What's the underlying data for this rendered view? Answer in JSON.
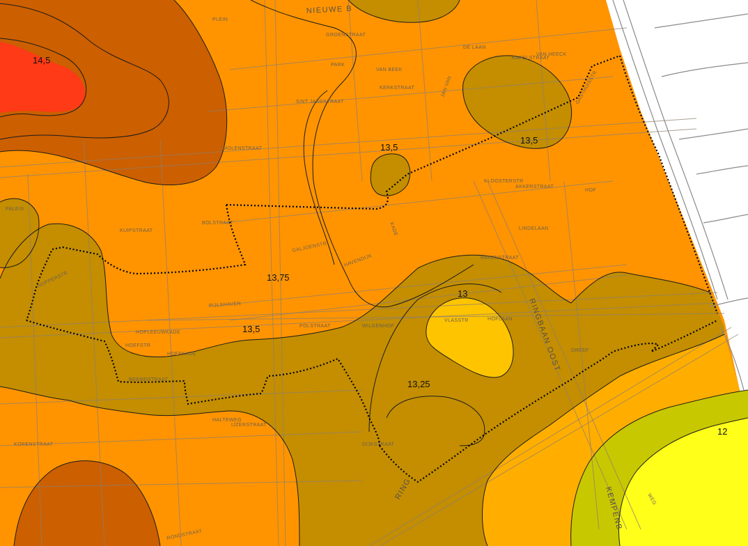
{
  "colors": {
    "zone_red": "#ff3a16",
    "zone_dark_orange": "#cc5f00",
    "zone_orange": "#ff9400",
    "zone_olive": "#c48e00",
    "zone_yellow_orange": "#ffc400",
    "zone_pale_orange": "#ffae00",
    "zone_yellow_green": "#c8c800",
    "zone_yellow": "#ffff1a",
    "outside": "#ffffff"
  },
  "contour_labels": {
    "l145": "14,5",
    "l135_top": "13,5",
    "l135_right": "13,5",
    "l1375": "13,75",
    "l135_mid": "13,5",
    "l13": "13",
    "l1325": "13,25",
    "l12": "12"
  },
  "streets": {
    "nieuwe": "NIEUWE B",
    "ringbaan_oost": "RINGBAAN OOST",
    "ringbaan_bottom": "RING",
    "kempenb": "KEMPENB",
    "pijlshaven": "PIJLSHAVEN",
    "bolstraat": "BOLSTRAAT",
    "kuipstraat": "KUIPSTRAAT",
    "galjoenstr": "GALJOENSTR",
    "havendijk": "HAVENDIJK",
    "hopperstr": "HOPPERSTR",
    "hopleeuwkade": "HOPLEEUWKADE",
    "rondstraat": "RONDSTRAAT",
    "halteweg": "HALTEWEG",
    "wilgenhof": "WILGENHOF",
    "molenstraat": "MOLENSTRAAT",
    "sintjansstraat": "SINT JANSSTRAAT",
    "paleis": "PALEIS",
    "hoflaan": "HOFLAAN",
    "vlasstr": "VLASSTR",
    "hoefstr": "HOEFSTR",
    "polstraat": "POLSTRAAT",
    "kerkstraat": "KERKSTRAAT",
    "akkerstraat": "AKKERSTRAAT",
    "lindelaan": "LINDELAAN",
    "beemdstraat": "BEEMDSTRAAT",
    "korenstraat": "KORENSTRAAT",
    "ijzerstraat": "IJZERSTRAAT",
    "groenstraat": "GROENSTRAAT",
    "havenstraat": "HAVENSTRAAT",
    "hoefkade": "HOEFKADE",
    "dijkstraat": "DIJKSTRAAT",
    "kapelstraat": "KAPELSTRAAT",
    "gasthuisstr": "GASTHUISSTR",
    "kloosterstr": "KLOOSTERSTR",
    "jan_van": "JAN VAN",
    "van_heeck": "VAN HEECK",
    "van_beek": "VAN BEEK",
    "de_laan": "DE LAAN",
    "weg": "WEG",
    "park": "PARK",
    "dreef": "DREEF",
    "hof": "HOF",
    "plein": "PLEIN",
    "kade": "KADE"
  }
}
